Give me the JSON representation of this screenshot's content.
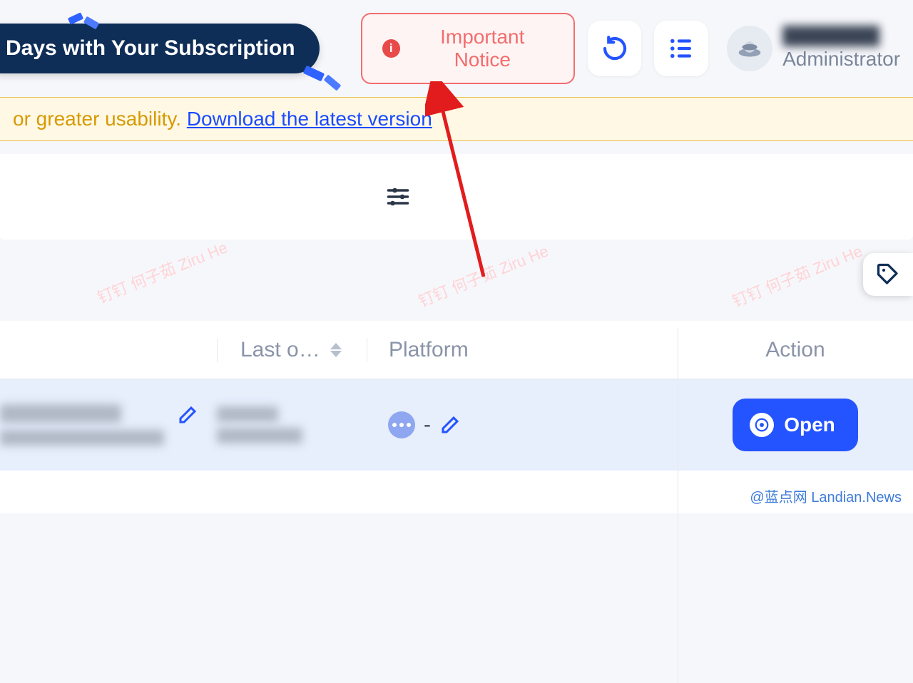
{
  "header": {
    "subscription_banner": "Days with Your Subscription",
    "notice_label": "Important Notice"
  },
  "user": {
    "name": "████████",
    "role": "Administrator"
  },
  "update_banner": {
    "prefix": "or greater usability. ",
    "link_text": "Download the latest version"
  },
  "watermark": "钉钉 何子茹 Ziru He",
  "table": {
    "columns": {
      "last_open": "Last o…",
      "platform": "Platform",
      "action": "Action"
    },
    "row0": {
      "platform_sep": " - ",
      "open_label": "Open"
    }
  },
  "source_label": "@蓝点网 Landian.News"
}
